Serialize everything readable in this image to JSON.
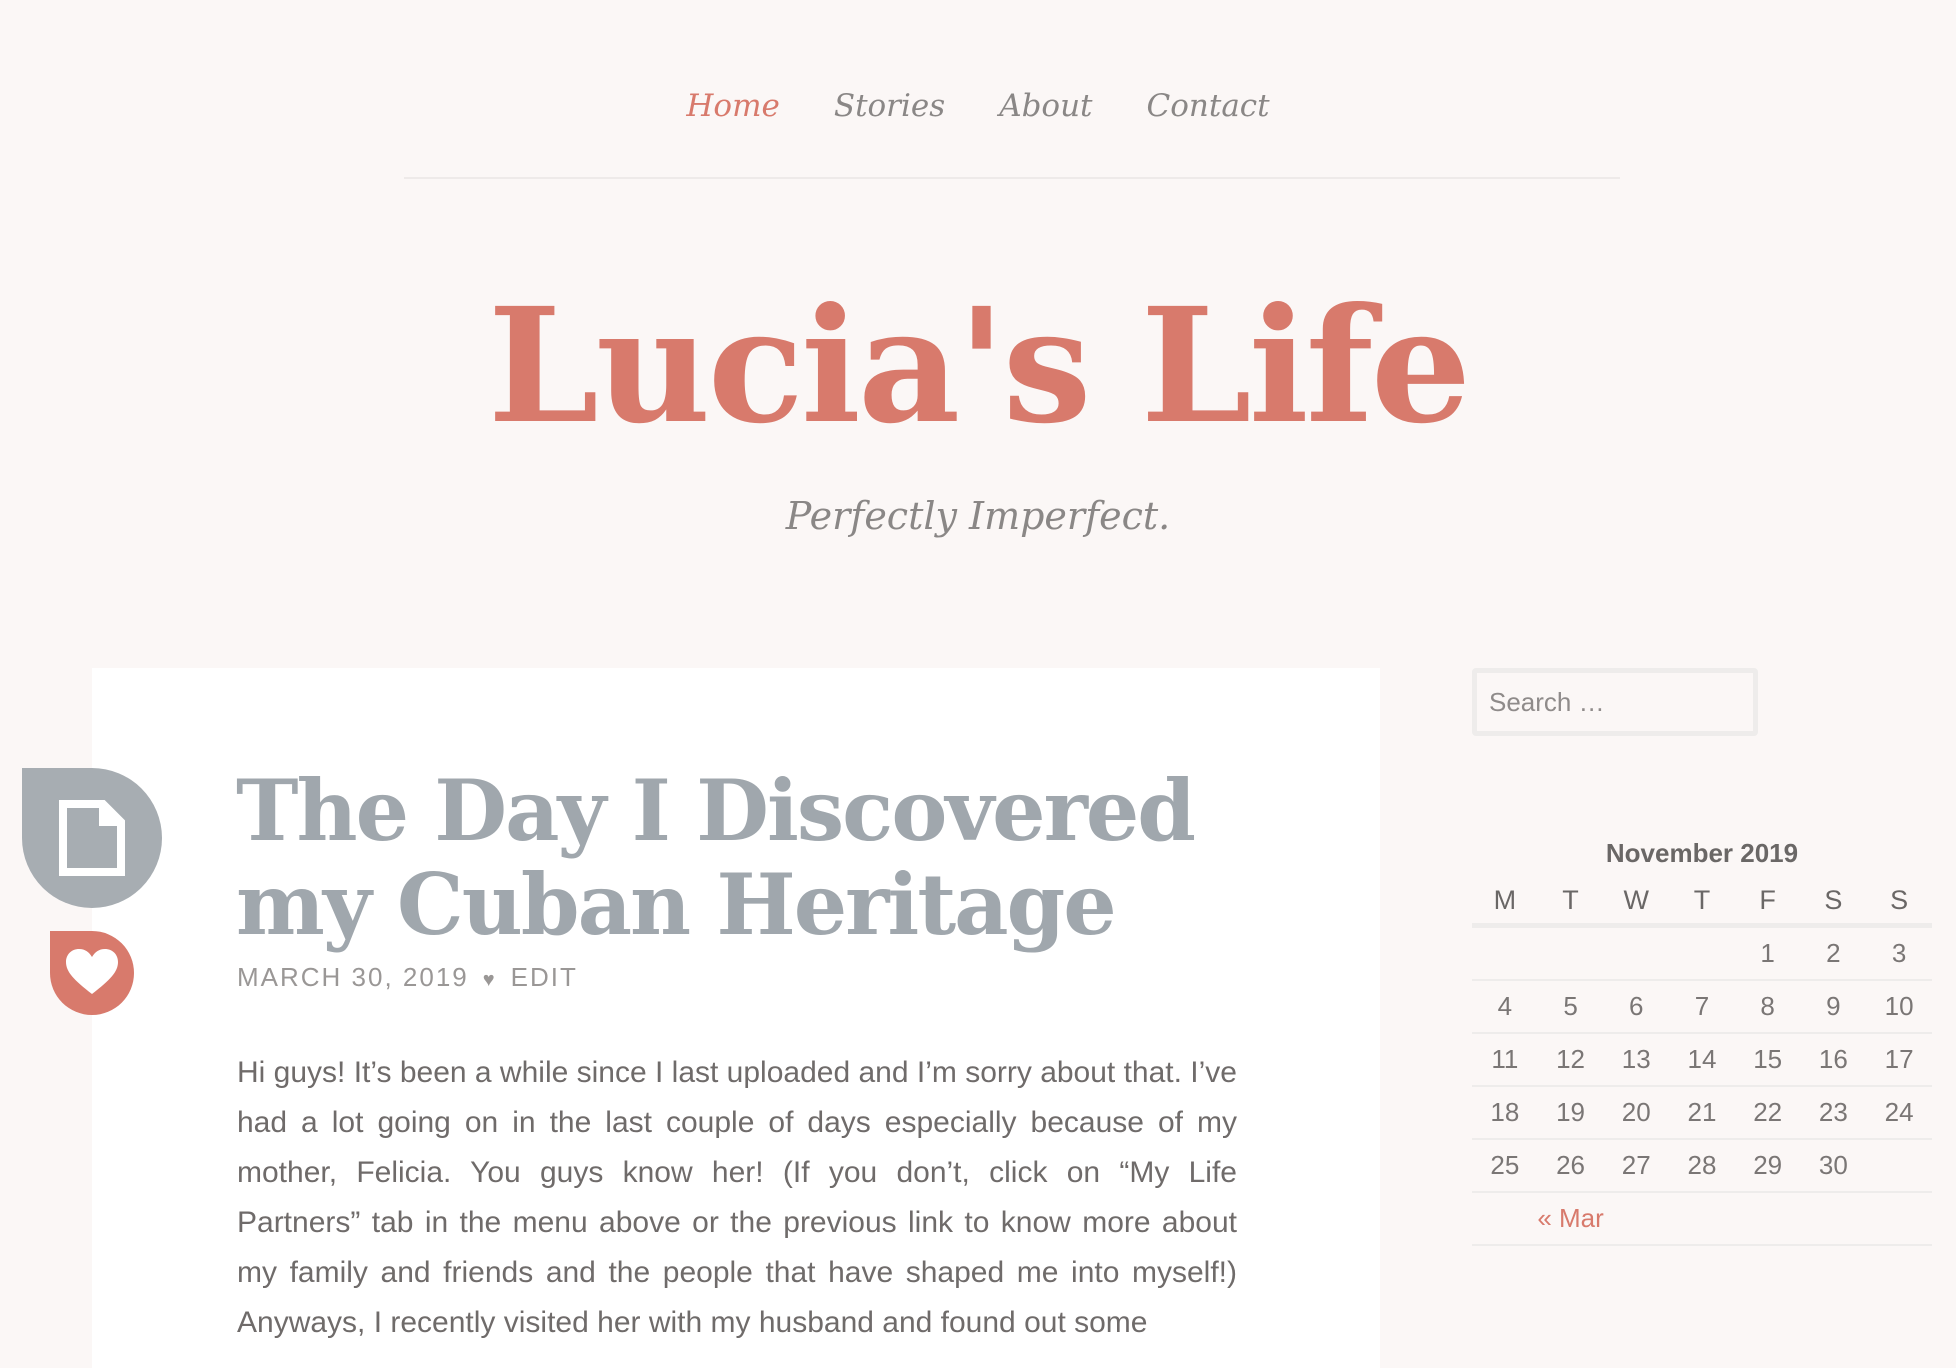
{
  "nav": {
    "items": [
      {
        "label": "Home"
      },
      {
        "label": "Stories"
      },
      {
        "label": "About"
      },
      {
        "label": "Contact"
      }
    ]
  },
  "site": {
    "title": "Lucia's Life",
    "tagline": "Perfectly Imperfect."
  },
  "post": {
    "title": "The Day I Discovered my Cuban Heritage",
    "date": "MARCH 30, 2019",
    "separator": "♥",
    "edit_label": "EDIT",
    "body": "Hi guys! It’s been a while since I last uploaded and I’m sorry about that. I’ve had a lot going on in the last couple of days especially because of my mother, Felicia. You guys know her! (If you don’t, click on “My Life Partners” tab in the menu above or the previous link to know more about my family and friends and the people that have shaped me into myself!) Anyways,  I recently visited her with my husband and found out some"
  },
  "sidebar": {
    "search_placeholder": "Search …",
    "calendar": {
      "caption": "November 2019",
      "weekdays": [
        "M",
        "T",
        "W",
        "T",
        "F",
        "S",
        "S"
      ],
      "weeks": [
        [
          "",
          "",
          "",
          "",
          "1",
          "2",
          "3"
        ],
        [
          "4",
          "5",
          "6",
          "7",
          "8",
          "9",
          "10"
        ],
        [
          "11",
          "12",
          "13",
          "14",
          "15",
          "16",
          "17"
        ],
        [
          "18",
          "19",
          "20",
          "21",
          "22",
          "23",
          "24"
        ],
        [
          "25",
          "26",
          "27",
          "28",
          "29",
          "30",
          ""
        ]
      ],
      "prev_link": "« Mar"
    }
  },
  "colors": {
    "accent": "#d87a6c",
    "background": "#fbf7f6",
    "title_gray": "#a0a7ad"
  }
}
